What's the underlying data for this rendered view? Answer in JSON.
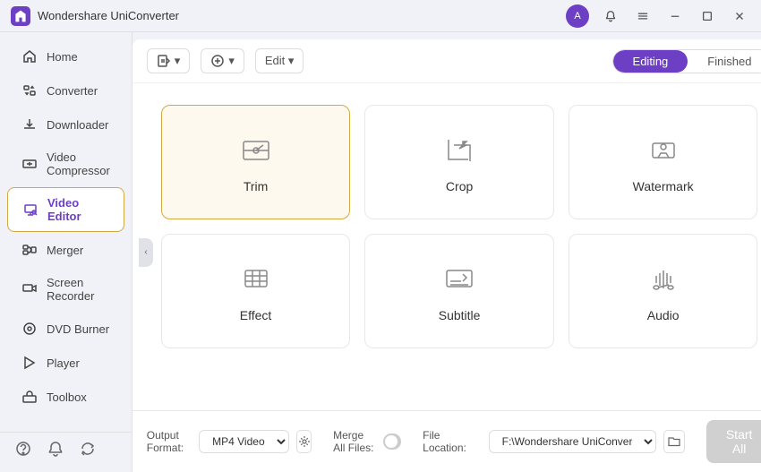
{
  "app": {
    "title": "Wondershare UniConverter",
    "logo_letter": "W"
  },
  "titlebar": {
    "avatar_letter": "A",
    "controls": [
      "profile",
      "bell",
      "menu",
      "minimize",
      "maximize",
      "close"
    ]
  },
  "sidebar": {
    "items": [
      {
        "id": "home",
        "label": "Home",
        "icon": "home"
      },
      {
        "id": "converter",
        "label": "Converter",
        "icon": "converter"
      },
      {
        "id": "downloader",
        "label": "Downloader",
        "icon": "downloader"
      },
      {
        "id": "video-compressor",
        "label": "Video Compressor",
        "icon": "compress"
      },
      {
        "id": "video-editor",
        "label": "Video Editor",
        "icon": "editor",
        "active": true
      },
      {
        "id": "merger",
        "label": "Merger",
        "icon": "merger"
      },
      {
        "id": "screen-recorder",
        "label": "Screen Recorder",
        "icon": "recorder"
      },
      {
        "id": "dvd-burner",
        "label": "DVD Burner",
        "icon": "dvd"
      },
      {
        "id": "player",
        "label": "Player",
        "icon": "player"
      },
      {
        "id": "toolbox",
        "label": "Toolbox",
        "icon": "toolbox"
      }
    ],
    "bottom_icons": [
      "help",
      "bell",
      "refresh"
    ]
  },
  "header": {
    "add_button": "+",
    "add_dropdown": "▾",
    "edit_dropdown": "Edit ▾",
    "tabs": [
      {
        "id": "editing",
        "label": "Editing",
        "active": true
      },
      {
        "id": "finished",
        "label": "Finished",
        "active": false
      }
    ]
  },
  "tools": [
    {
      "id": "trim",
      "label": "Trim",
      "selected": true
    },
    {
      "id": "crop",
      "label": "Crop",
      "selected": false
    },
    {
      "id": "watermark",
      "label": "Watermark",
      "selected": false
    },
    {
      "id": "effect",
      "label": "Effect",
      "selected": false
    },
    {
      "id": "subtitle",
      "label": "Subtitle",
      "selected": false
    },
    {
      "id": "audio",
      "label": "Audio",
      "selected": false
    }
  ],
  "bottom_bar": {
    "output_format_label": "Output Format:",
    "output_format_value": "MP4 Video",
    "merge_all_label": "Merge All Files:",
    "file_location_label": "File Location:",
    "file_location_value": "F:\\Wondershare UniConverter",
    "start_all_label": "Start All"
  }
}
